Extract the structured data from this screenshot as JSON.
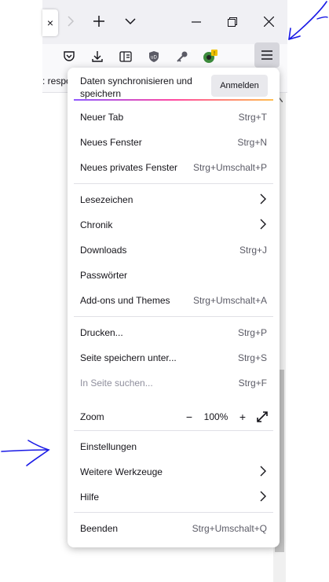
{
  "browser": {
    "tab_close_glyph": "×",
    "tabbar_icons": [
      "forward-arrow-icon",
      "plus-icon",
      "chevron-down-icon",
      "minimize-icon",
      "restore-icon",
      "close-icon"
    ],
    "toolbar_icons": [
      "pocket-icon",
      "download-icon",
      "reader-view-icon",
      "ublock-icon",
      "key-icon",
      "extension-icon",
      "hamburger-menu-icon"
    ],
    "bookmark_fragment": ": respo"
  },
  "menu": {
    "sync": {
      "text": "Daten synchronisieren und speichern",
      "button": "Anmelden"
    },
    "groups": [
      [
        {
          "label": "Neuer Tab",
          "shortcut": "Strg+T"
        },
        {
          "label": "Neues Fenster",
          "shortcut": "Strg+N"
        },
        {
          "label": "Neues privates Fenster",
          "shortcut": "Strg+Umschalt+P"
        }
      ],
      [
        {
          "label": "Lesezeichen",
          "chevron": true
        },
        {
          "label": "Chronik",
          "chevron": true
        },
        {
          "label": "Downloads",
          "shortcut": "Strg+J"
        },
        {
          "label": "Passwörter"
        },
        {
          "label": "Add-ons und Themes",
          "shortcut": "Strg+Umschalt+A"
        }
      ],
      [
        {
          "label": "Drucken...",
          "shortcut": "Strg+P"
        },
        {
          "label": "Seite speichern unter...",
          "shortcut": "Strg+S"
        },
        {
          "label": "In Seite suchen...",
          "shortcut": "Strg+F",
          "disabled": true
        }
      ],
      [
        {
          "label": "Einstellungen"
        },
        {
          "label": "Weitere Werkzeuge",
          "chevron": true
        },
        {
          "label": "Hilfe",
          "chevron": true
        }
      ],
      [
        {
          "label": "Beenden",
          "shortcut": "Strg+Umschalt+Q"
        }
      ]
    ],
    "zoom": {
      "label": "Zoom",
      "minus": "−",
      "value": "100%",
      "plus": "+"
    }
  },
  "colors": {
    "annotation": "#1a1ae6",
    "gradient": [
      "#9059ff",
      "#ff4aa2",
      "#ffbd4f"
    ]
  }
}
